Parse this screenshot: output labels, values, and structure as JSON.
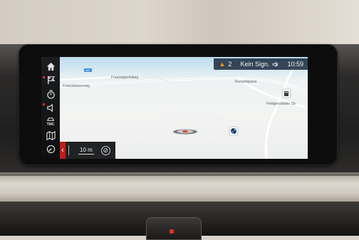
{
  "status_bar": {
    "warning_count": "2",
    "signal_text": "Kein Sign.",
    "time": "10:59"
  },
  "map": {
    "streets": {
      "a": "Franziskanerweg",
      "b": "Franzeppichstieg",
      "c": "Rumpelgasse",
      "d": "Heiligenstädter Str."
    },
    "ref_tag": "387",
    "scale_label": "10 m"
  },
  "sidebar": {
    "items": [
      "home-icon",
      "destination-flag-icon",
      "timer-icon",
      "voice-icon",
      "tmc-icon",
      "map-view-icon",
      "compass-icon"
    ],
    "tmc_label": "TMC"
  },
  "colors": {
    "accent_red": "#b7201c",
    "warning_orange": "#ff9a1a",
    "status_bg": "#142234"
  }
}
